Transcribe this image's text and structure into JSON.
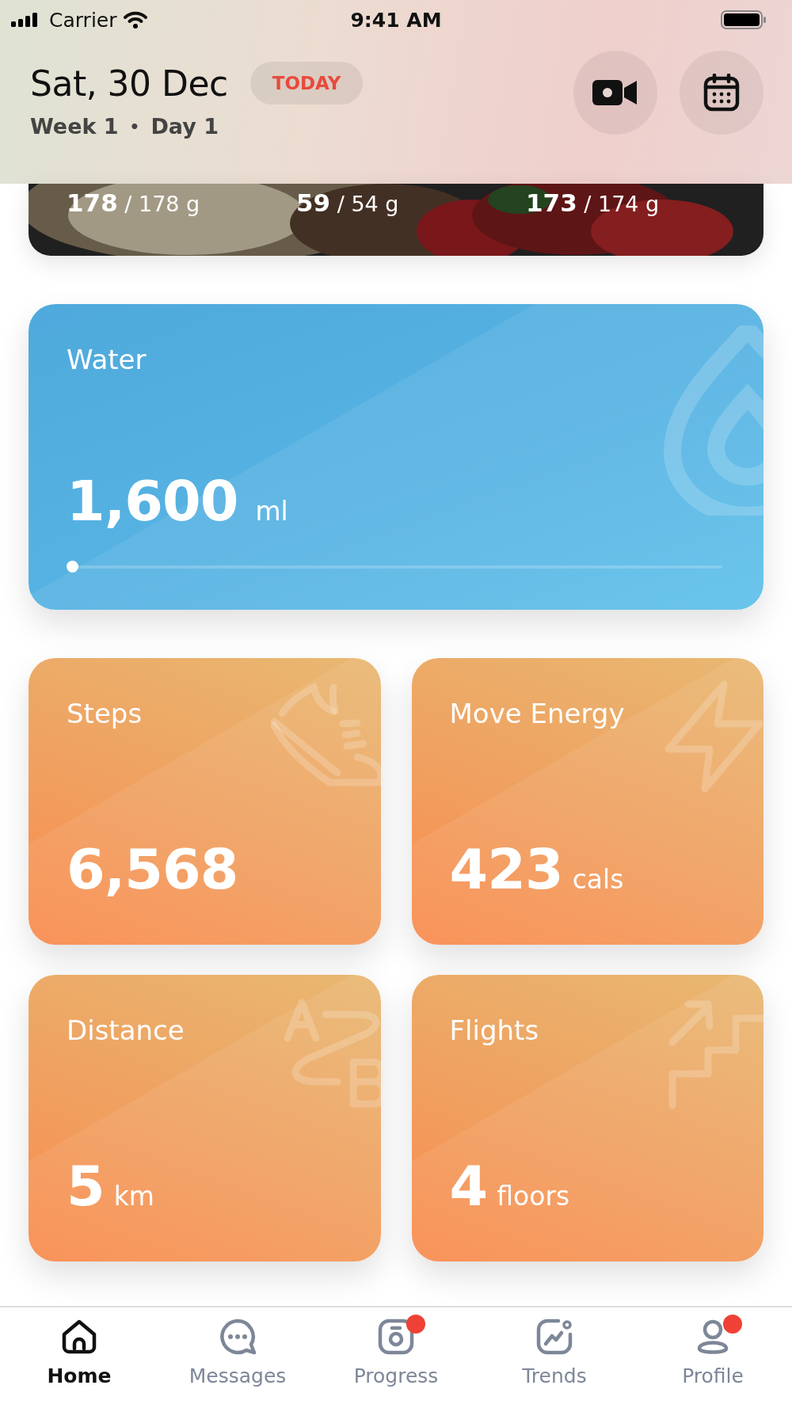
{
  "status_bar": {
    "carrier": "Carrier",
    "time": "9:41 AM"
  },
  "header": {
    "date": "Sat, 30 Dec",
    "today_badge": "TODAY",
    "week": "Week 1",
    "separator": "•",
    "day": "Day 1"
  },
  "meal_card": {
    "kind": "picture",
    "macros": [
      {
        "value": "178",
        "target": "/ 178 g"
      },
      {
        "value": "59",
        "target": "/ 54 g"
      },
      {
        "value": "173",
        "target": "/ 174 g"
      }
    ]
  },
  "water": {
    "title": "Water",
    "value": "1,600",
    "unit": "ml",
    "level": 0
  },
  "tiles": [
    {
      "kind": "steps",
      "title": "Steps",
      "value": "6,568"
    },
    {
      "kind": "energy",
      "title": "Move Energy",
      "value": "423",
      "unit": "cals"
    },
    {
      "kind": "distance",
      "title": "Distance",
      "value": "5",
      "unit": "km"
    },
    {
      "kind": "flights",
      "title": "Flights",
      "value": "4",
      "unit": "floors"
    }
  ],
  "tab_bar": [
    {
      "kind": "home",
      "label": "Home",
      "selected": true,
      "badge": false
    },
    {
      "kind": "messages",
      "label": "Messages",
      "selected": false,
      "badge": false
    },
    {
      "kind": "progress",
      "label": "Progress",
      "selected": false,
      "badge": true
    },
    {
      "kind": "trends",
      "label": "Trends",
      "selected": false,
      "badge": false
    },
    {
      "kind": "profile",
      "label": "Profile",
      "selected": false,
      "badge": true
    }
  ]
}
